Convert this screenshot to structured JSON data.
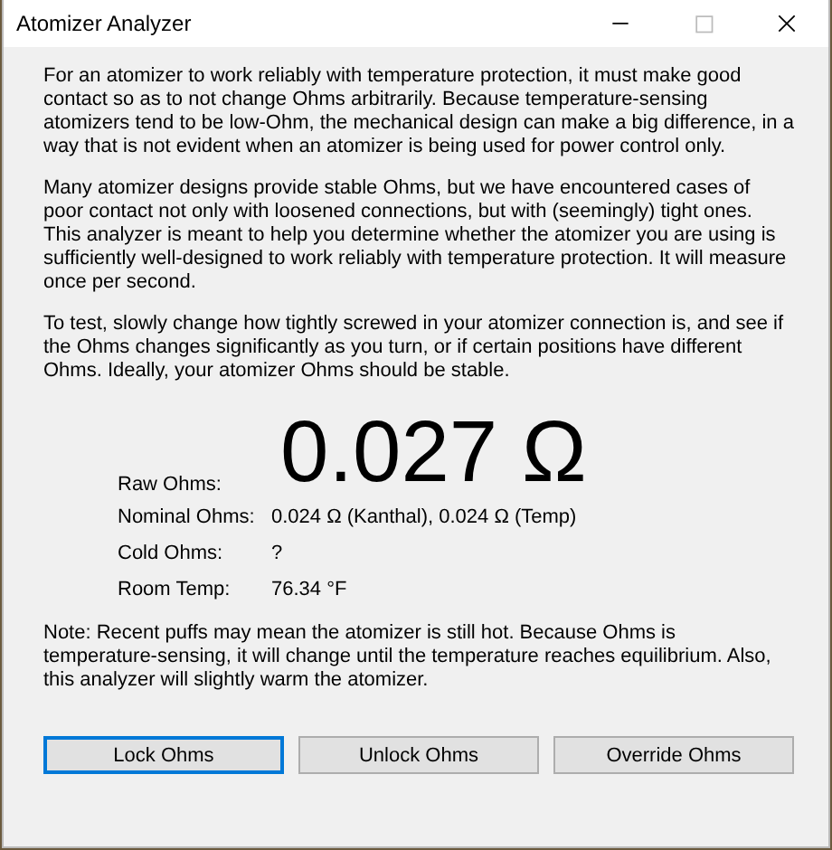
{
  "window": {
    "title": "Atomizer Analyzer"
  },
  "paragraphs": [
    "For an atomizer to work reliably with temperature protection, it must make good contact so as to not change Ohms arbitrarily. Because temperature-sensing atomizers tend to be low-Ohm, the mechanical design can make a big difference, in a way that is not evident when an atomizer is being used for power control only.",
    "Many atomizer designs provide stable Ohms, but we have encountered cases of poor contact not only with loosened connections, but with (seemingly) tight ones. This analyzer is meant to help you determine whether the atomizer you are using is sufficiently well-designed to work reliably with temperature protection. It will measure once per second.",
    "To test, slowly change how tightly screwed in your atomizer connection is, and see if the Ohms changes significantly as you turn, or if certain positions have different Ohms. Ideally, your atomizer Ohms should be stable."
  ],
  "raw_ohms": {
    "label": "Raw Ohms:",
    "value": "0.027 Ω"
  },
  "readings": [
    {
      "label": "Nominal Ohms:",
      "value": "0.024 Ω (Kanthal), 0.024 Ω (Temp)"
    },
    {
      "label": "Cold Ohms:",
      "value": "?"
    },
    {
      "label": "Room Temp:",
      "value": "76.34 °F"
    }
  ],
  "note": "Note: Recent puffs may mean the atomizer is still hot. Because Ohms is temperature-sensing, it will change until the temperature reaches equilibrium. Also, this analyzer will slightly warm the atomizer.",
  "buttons": [
    {
      "label": "Lock Ohms",
      "focused": true
    },
    {
      "label": "Unlock Ohms",
      "focused": false
    },
    {
      "label": "Override Ohms",
      "focused": false
    }
  ]
}
